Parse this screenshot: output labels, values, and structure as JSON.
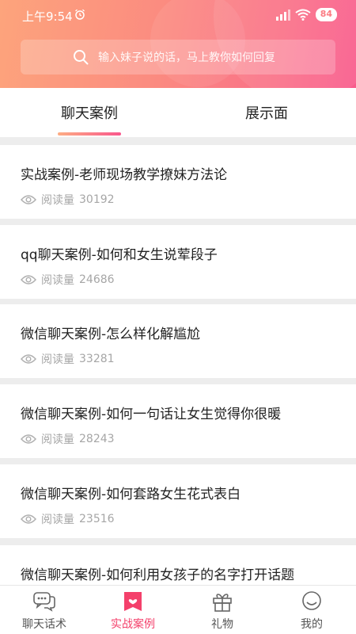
{
  "status": {
    "time": "上午9:54",
    "battery": "84"
  },
  "search": {
    "placeholder": "输入妹子说的话，马上教你如何回复"
  },
  "tabs": [
    {
      "label": "聊天案例",
      "active": true
    },
    {
      "label": "展示面",
      "active": false
    }
  ],
  "articles": [
    {
      "title": "实战案例-老师现场教学撩妹方法论",
      "views_label": "阅读量",
      "views": "30192"
    },
    {
      "title": "qq聊天案例-如何和女生说荤段子",
      "views_label": "阅读量",
      "views": "24686"
    },
    {
      "title": "微信聊天案例-怎么样化解尴尬",
      "views_label": "阅读量",
      "views": "33281"
    },
    {
      "title": "微信聊天案例-如何一句话让女生觉得你很暖",
      "views_label": "阅读量",
      "views": "28243"
    },
    {
      "title": "微信聊天案例-如何套路女生花式表白",
      "views_label": "阅读量",
      "views": "23516"
    },
    {
      "title": "微信聊天案例-如何利用女孩子的名字打开话题",
      "views_label": "",
      "views": ""
    }
  ],
  "bottom_nav": [
    {
      "label": "聊天话术",
      "icon": "chat-bubbles-icon",
      "active": false
    },
    {
      "label": "实战案例",
      "icon": "bookmark-heart-icon",
      "active": true
    },
    {
      "label": "礼物",
      "icon": "gift-icon",
      "active": false
    },
    {
      "label": "我的",
      "icon": "smile-face-icon",
      "active": false
    }
  ],
  "colors": {
    "accent": "#f4406b",
    "gradient_start": "#fda47c",
    "gradient_end": "#f95b8c"
  }
}
